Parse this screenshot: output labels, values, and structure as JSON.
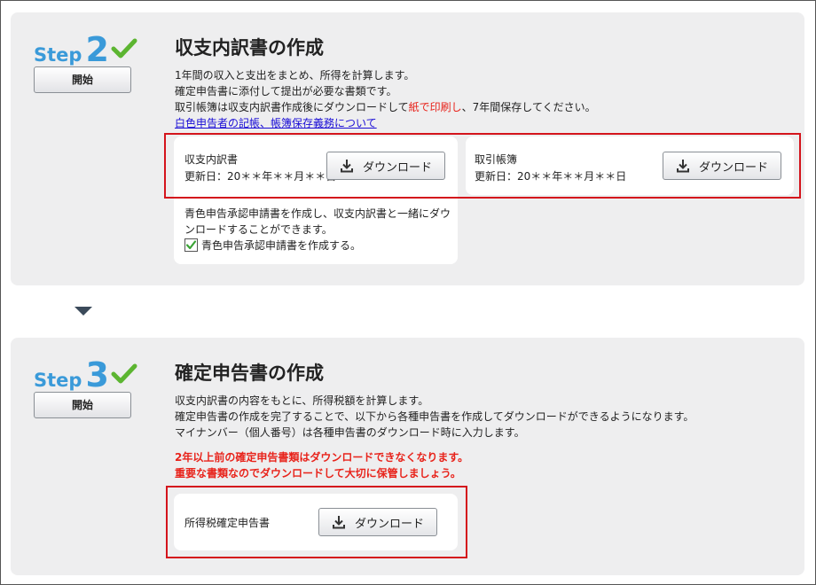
{
  "step2": {
    "step_word": "Step",
    "step_num": "2",
    "start_label": "開始",
    "title": "収支内訳書の作成",
    "desc_line1": "1年間の収入と支出をまとめ、所得を計算します。",
    "desc_line2": "確定申告書に添付して提出が必要な書類です。",
    "desc_line3_pre": "取引帳簿は収支内訳書作成後にダウンロードして",
    "desc_line3_red": "紙で印刷し",
    "desc_line3_post": "、7年間保存してください。",
    "link_label": "白色申告者の記帳、帳簿保存義務について",
    "card1": {
      "name": "収支内訳書",
      "updated": "更新日：20＊＊年＊＊月＊＊日",
      "button_label": "ダウンロード"
    },
    "card2": {
      "name": "取引帳簿",
      "updated": "更新日：20＊＊年＊＊月＊＊日",
      "button_label": "ダウンロード"
    },
    "blue_note_line1": "青色申告承認申請書を作成し、収支内訳書と一緒にダウ",
    "blue_note_line2": "ンロードすることができます。",
    "checkbox_label": "青色申告承認申請書を作成する。"
  },
  "step3": {
    "step_word": "Step",
    "step_num": "3",
    "start_label": "開始",
    "title": "確定申告書の作成",
    "desc_line1": "収支内訳書の内容をもとに、所得税額を計算します。",
    "desc_line2": "確定申告書の作成を完了することで、以下から各種申告書を作成してダウンロードができるようになります。",
    "desc_line3": "マイナンバー（個人番号）は各種申告書のダウンロード時に入力します。",
    "warn_line1": "2年以上前の確定申告書類はダウンロードできなくなります。",
    "warn_line2": "重要な書類なのでダウンロードして大切に保管しましょう。",
    "card": {
      "name": "所得税確定申告書",
      "button_label": "ダウンロード"
    }
  },
  "colors": {
    "step_blue": "#3a9ad9",
    "check_green": "#5cb531",
    "highlight_red": "#d4141c",
    "warning_red": "#e8231b",
    "link_blue": "#1a0dd6"
  }
}
